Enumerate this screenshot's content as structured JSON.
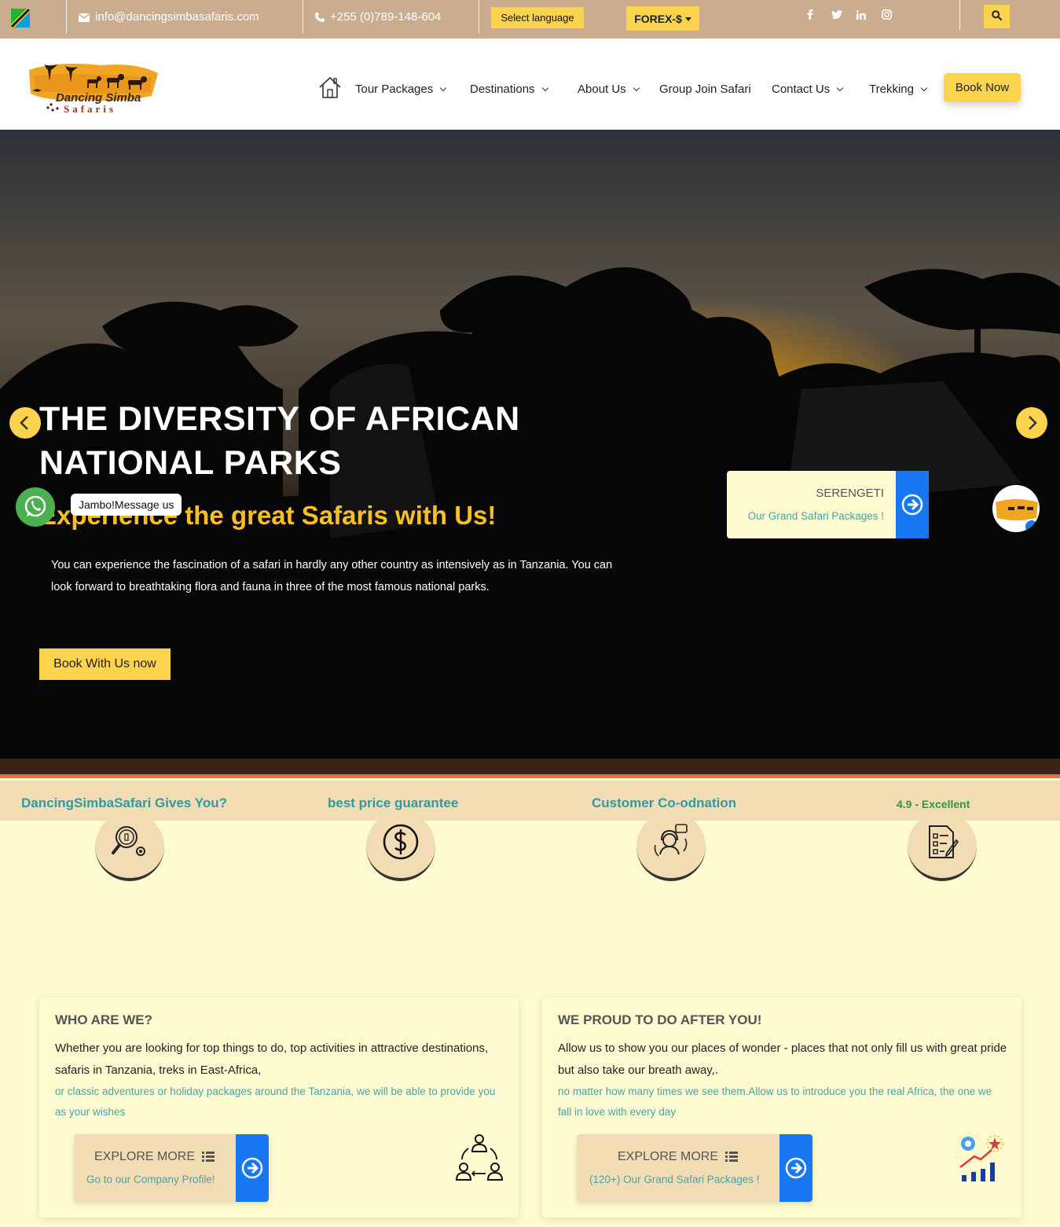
{
  "topbar": {
    "email": "info@dancingsimbasafaris.com",
    "phone": "+255 (0)789-148-604",
    "language_button": "Select language",
    "forex_button": "FOREX-$",
    "social": [
      {
        "icon": "facebook-icon",
        "glyph": "f"
      },
      {
        "icon": "twitter-icon",
        "glyph": "t"
      },
      {
        "icon": "linkedin-icon",
        "glyph": "in"
      },
      {
        "icon": "instagram-icon",
        "glyph": "ig"
      }
    ],
    "accent": "#fcd34d",
    "background": "#c9ad8e"
  },
  "header": {
    "logo_line1": "Dancing Simba",
    "logo_line2": "Safaris",
    "nav": [
      {
        "label": "Tour Packages",
        "has_dropdown": true
      },
      {
        "label": "Destinations",
        "has_dropdown": true
      },
      {
        "label": "About Us",
        "has_dropdown": true
      },
      {
        "label": "Group Join Safari",
        "has_dropdown": false
      },
      {
        "label": "Contact Us",
        "has_dropdown": true
      },
      {
        "label": "Trekking",
        "has_dropdown": true
      }
    ],
    "book_button": "Book Now"
  },
  "hero": {
    "title": "THE DIVERSITY OF AFRICAN NATIONAL PARKS",
    "subtitle": "Experience the great Safaris with Us!",
    "paragraph": "You can experience the fascination of a safari in hardly any other country as intensively as in Tanzania. You can look forward to breathtaking flora and fauna in three of the most famous national parks.",
    "cta": "Book With Us now",
    "promo_title": "SERENGETI",
    "promo_link": "Our Grand Safari Packages !",
    "whatsapp_tip": "Jambo!Message us",
    "subtitle_color": "#fbbf24"
  },
  "features": {
    "items": [
      {
        "title": "DancingSimbaSafari Gives You?",
        "icon": "search-gear-icon"
      },
      {
        "title": "best price guarantee",
        "icon": "dollar-icon"
      },
      {
        "title": "Customer Co-odnation",
        "icon": "support-agent-icon"
      },
      {
        "title": "",
        "icon": "checklist-icon"
      }
    ],
    "rating": "4.9 - Excellent",
    "title_color": "#2f9aa3"
  },
  "cards": [
    {
      "heading": "WHO ARE WE?",
      "text": "Whether you are looking for top things to do, top activities in attractive destinations, safaris in Tanzania, treks in East-Africa,",
      "text_accent": "or classic adventures or holiday packages around the Tanzania, we will be able to provide you as your wishes",
      "button_title": "EXPLORE MORE",
      "button_sub": "Go to our Company Profile!",
      "icon": "team-network-icon"
    },
    {
      "heading": "WE PROUD TO DO AFTER YOU!",
      "text": "Allow us to show you our places of wonder - places that not only fill us with great pride but also take our breath away,.",
      "text_accent": "no matter how many times we see them.Allow us to introduce you the real Africa, the one we fall in love with every day",
      "button_title": "EXPLORE MORE",
      "button_sub": "(120+) Our Grand Safari Packages !",
      "icon": "growth-chart-icon"
    }
  ]
}
